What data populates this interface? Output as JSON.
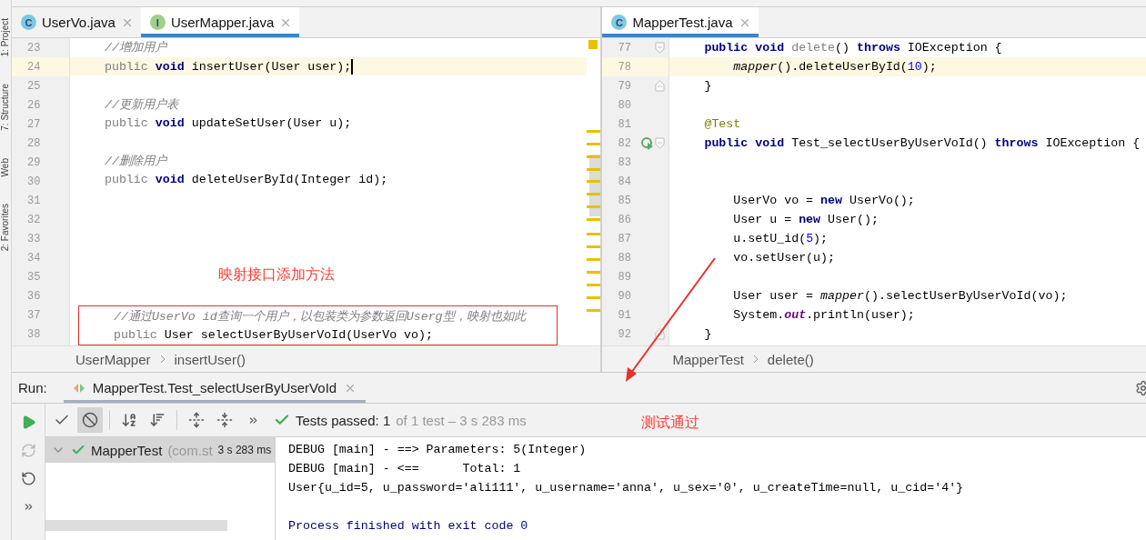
{
  "side_strip": [
    {
      "label": "1: Project"
    },
    {
      "label": "7: Structure"
    },
    {
      "label": "Web"
    },
    {
      "label": "2: Favorites"
    }
  ],
  "editors": [
    {
      "tabs": [
        {
          "label": "UserVo.java",
          "kind": "class",
          "icon_letter": "C",
          "selected": false
        },
        {
          "label": "UserMapper.java",
          "kind": "interface",
          "icon_letter": "I",
          "selected": true
        }
      ],
      "lines": [
        {
          "number": "23",
          "current": false,
          "tokens": [
            {
              "kind": "comment",
              "text": "    //增加用户"
            }
          ]
        },
        {
          "number": "24",
          "current": true,
          "caret": true,
          "tokens": [
            {
              "kind": "redundant",
              "text": "    public "
            },
            {
              "kind": "keyword",
              "text": "void "
            },
            {
              "kind": "plain",
              "text": "insertUser(User user);"
            }
          ]
        },
        {
          "number": "25",
          "current": false
        },
        {
          "number": "26",
          "current": false,
          "tokens": [
            {
              "kind": "comment",
              "text": "    //更新用户表"
            }
          ]
        },
        {
          "number": "27",
          "current": false,
          "tokens": [
            {
              "kind": "redundant",
              "text": "    public "
            },
            {
              "kind": "keyword",
              "text": "void "
            },
            {
              "kind": "plain",
              "text": "updateSetUser(User u);"
            }
          ]
        },
        {
          "number": "28",
          "current": false
        },
        {
          "number": "29",
          "current": false,
          "tokens": [
            {
              "kind": "comment",
              "text": "    //删除用户"
            }
          ]
        },
        {
          "number": "30",
          "current": false,
          "tokens": [
            {
              "kind": "redundant",
              "text": "    public "
            },
            {
              "kind": "keyword",
              "text": "void "
            },
            {
              "kind": "plain",
              "text": "deleteUserById(Integer id);"
            }
          ]
        },
        {
          "number": "31",
          "current": false
        },
        {
          "number": "32",
          "current": false
        },
        {
          "number": "33",
          "current": false
        },
        {
          "number": "34",
          "current": false
        },
        {
          "number": "35",
          "current": false
        },
        {
          "number": "36",
          "current": false
        },
        {
          "number": "37",
          "current": false,
          "boxed": true,
          "tokens": [
            {
              "kind": "comment",
              "text": "    //通过UserVo id查询一个用户，以包装类为参数返回Userg型，映射也如此"
            }
          ]
        },
        {
          "number": "38",
          "current": false,
          "boxed": true,
          "tokens": [
            {
              "kind": "redundant",
              "text": "    public "
            },
            {
              "kind": "plain",
              "text": "User selectUserByUserVoId(UserVo vo);"
            }
          ]
        }
      ],
      "breadcrumb": [
        "UserMapper",
        "insertUser()"
      ]
    },
    {
      "tabs": [
        {
          "label": "MapperTest.java",
          "kind": "test",
          "icon_letter": "C",
          "selected": true
        }
      ],
      "lines": [
        {
          "number": "77",
          "current": false,
          "fold_start": true,
          "tokens": [
            {
              "kind": "keyword",
              "text": "    public void "
            },
            {
              "kind": "unused",
              "text": "delete"
            },
            {
              "kind": "plain",
              "text": "() "
            },
            {
              "kind": "keyword",
              "text": "throws "
            },
            {
              "kind": "plain",
              "text": "IOException {"
            }
          ]
        },
        {
          "number": "78",
          "current": true,
          "tokens": [
            {
              "kind": "italic",
              "text": "        mapper"
            },
            {
              "kind": "plain",
              "text": "().deleteUserById("
            },
            {
              "kind": "number",
              "text": "10"
            },
            {
              "kind": "plain",
              "text": ");"
            }
          ]
        },
        {
          "number": "79",
          "current": false,
          "fold_end": true,
          "tokens": [
            {
              "kind": "plain",
              "text": "    }"
            }
          ]
        },
        {
          "number": "80",
          "current": false
        },
        {
          "number": "81",
          "current": false,
          "tokens": [
            {
              "kind": "annotation",
              "text": "    @Test"
            }
          ]
        },
        {
          "number": "82",
          "current": false,
          "run_icon": true,
          "fold_start": true,
          "tokens": [
            {
              "kind": "keyword",
              "text": "    public void "
            },
            {
              "kind": "plain",
              "text": "Test_selectUserByUserVoId() "
            },
            {
              "kind": "keyword",
              "text": "throws "
            },
            {
              "kind": "plain",
              "text": "IOException {"
            }
          ]
        },
        {
          "number": "83",
          "current": false
        },
        {
          "number": "84",
          "current": false
        },
        {
          "number": "85",
          "current": false,
          "tokens": [
            {
              "kind": "plain",
              "text": "        UserVo vo = "
            },
            {
              "kind": "keyword",
              "text": "new "
            },
            {
              "kind": "plain",
              "text": "UserVo();"
            }
          ]
        },
        {
          "number": "86",
          "current": false,
          "tokens": [
            {
              "kind": "plain",
              "text": "        User u = "
            },
            {
              "kind": "keyword",
              "text": "new "
            },
            {
              "kind": "plain",
              "text": "User();"
            }
          ]
        },
        {
          "number": "87",
          "current": false,
          "tokens": [
            {
              "kind": "plain",
              "text": "        u.setU_id("
            },
            {
              "kind": "number",
              "text": "5"
            },
            {
              "kind": "plain",
              "text": ");"
            }
          ]
        },
        {
          "number": "88",
          "current": false,
          "tokens": [
            {
              "kind": "plain",
              "text": "        vo.setUser(u);"
            }
          ]
        },
        {
          "number": "89",
          "current": false
        },
        {
          "number": "90",
          "current": false,
          "tokens": [
            {
              "kind": "plain",
              "text": "        User user = "
            },
            {
              "kind": "italic",
              "text": "mapper"
            },
            {
              "kind": "plain",
              "text": "().selectUserByUserVoId(vo);"
            }
          ]
        },
        {
          "number": "91",
          "current": false,
          "tokens": [
            {
              "kind": "plain",
              "text": "        System."
            },
            {
              "kind": "static_field",
              "text": "out"
            },
            {
              "kind": "plain",
              "text": ".println(user);"
            }
          ]
        },
        {
          "number": "92",
          "current": false,
          "fold_end": true,
          "tokens": [
            {
              "kind": "plain",
              "text": "    }"
            }
          ]
        }
      ],
      "breadcrumb": [
        "MapperTest",
        "delete()"
      ]
    }
  ],
  "annotations": {
    "method_note": "映射接口添加方法",
    "test_note": "测试通过"
  },
  "run": {
    "label": "Run:",
    "tab": {
      "label": "MapperTest.Test_selectUserByUserVoId",
      "selected": true
    },
    "actions": [
      {
        "kind": "play",
        "disabled": false
      },
      {
        "kind": "rerun",
        "disabled": true
      },
      {
        "kind": "toggle",
        "disabled": false
      },
      {
        "kind": "more",
        "disabled": false
      }
    ],
    "toolbar": [
      {
        "kind": "check",
        "pressed": false
      },
      {
        "kind": "stop",
        "pressed": true
      },
      {
        "kind": "sort",
        "pressed": false
      },
      {
        "kind": "duration",
        "pressed": false
      },
      {
        "kind": "expand",
        "pressed": false
      },
      {
        "kind": "collapse",
        "pressed": false
      },
      {
        "kind": "more",
        "pressed": false
      }
    ],
    "status": {
      "passed": "Tests passed: 1",
      "detail": "of 1 test – 3 s 283 ms"
    },
    "tree": [
      {
        "name": "MapperTest",
        "package": "(com.st",
        "time": "3 s 283 ms",
        "expanded": true,
        "selected": true
      }
    ],
    "console": [
      {
        "kind": "output",
        "text": "DEBUG [main] - ==> Parameters: 5(Integer)"
      },
      {
        "kind": "output",
        "text": "DEBUG [main] - <==      Total: 1"
      },
      {
        "kind": "output",
        "text": "User{u_id=5, u_password='ali111', u_username='anna', u_sex='0', u_createTime=null, u_cid='4'}"
      },
      {
        "kind": "system",
        "text": "Process finished with exit code 0"
      }
    ]
  }
}
